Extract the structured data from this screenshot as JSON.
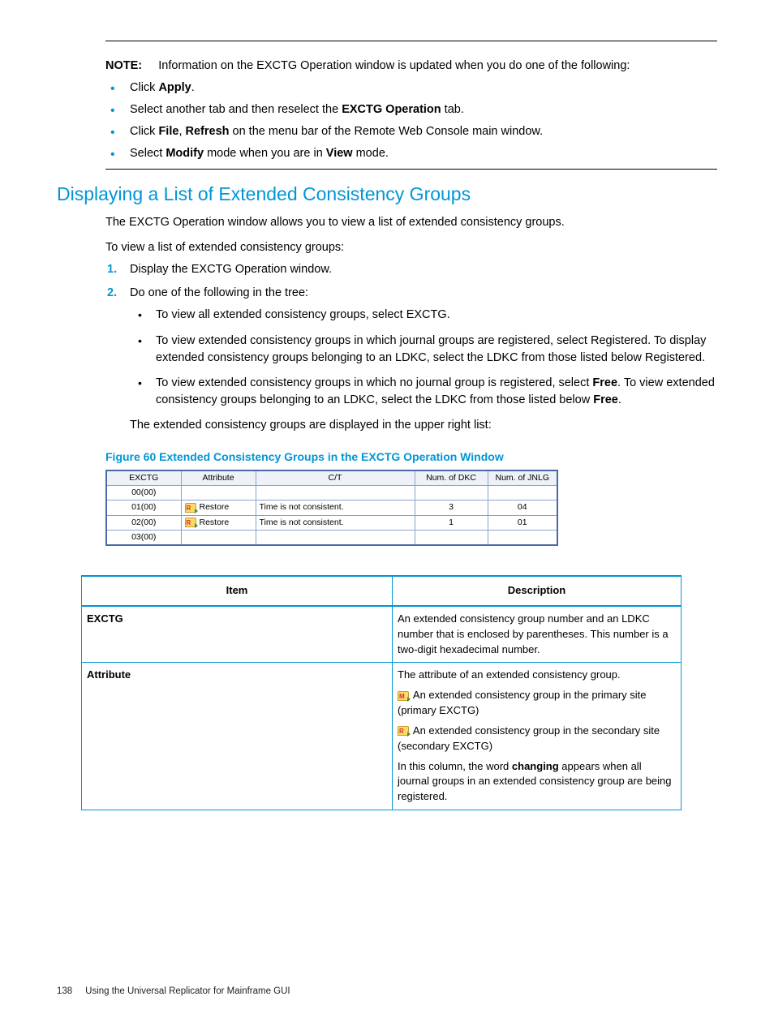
{
  "note": {
    "label": "NOTE:",
    "text": "Information on the EXCTG Operation window is updated when you do one of the following:",
    "bullets": [
      {
        "pre": "Click ",
        "b1": "Apply",
        "post": "."
      },
      {
        "pre": "Select another tab and then reselect the ",
        "b1": "EXCTG Operation",
        "post": " tab."
      },
      {
        "pre": "Click ",
        "b1": "File",
        "mid": ", ",
        "b2": "Refresh",
        "post": " on the menu bar of the Remote Web Console main window."
      },
      {
        "pre": "Select ",
        "b1": "Modify",
        "mid": " mode when you are in ",
        "b2": "View",
        "post": " mode."
      }
    ]
  },
  "section": {
    "heading": "Displaying a List of Extended Consistency Groups",
    "intro1": "The EXCTG Operation window allows you to view a list of extended consistency groups.",
    "intro2": "To view a list of extended consistency groups:",
    "step1": "Display the EXCTG Operation window.",
    "step2_lead": "Do one of the following in the tree:",
    "step2_items": [
      "To view all extended consistency groups, select EXCTG.",
      "To view extended consistency groups in which journal groups are registered, select Registered. To display extended consistency groups belonging to an LDKC, select the LDKC from those listed below Registered."
    ],
    "step2_item3": {
      "pre": "To view extended consistency groups in which no journal group is registered, select ",
      "b1": "Free",
      "mid": ". To view extended consistency groups belonging to an LDKC, select the LDKC from those listed below ",
      "b2": "Free",
      "post": "."
    },
    "after_list": "The extended consistency groups are displayed in the upper right list:",
    "figure_caption": "Figure 60 Extended Consistency Groups in the EXCTG Operation Window"
  },
  "grid": {
    "headers": [
      "EXCTG",
      "Attribute",
      "C/T",
      "Num. of DKC",
      "Num. of JNLG"
    ],
    "rows": [
      {
        "exctg": "00(00)",
        "attr": "",
        "icon": false,
        "ct": "",
        "dkc": "",
        "jnlg": ""
      },
      {
        "exctg": "01(00)",
        "attr": "Restore",
        "icon": true,
        "ct": "Time is not consistent.",
        "dkc": "3",
        "jnlg": "04"
      },
      {
        "exctg": "02(00)",
        "attr": "Restore",
        "icon": true,
        "ct": "Time is not consistent.",
        "dkc": "1",
        "jnlg": "01"
      },
      {
        "exctg": "03(00)",
        "attr": "",
        "icon": false,
        "ct": "",
        "dkc": "",
        "jnlg": ""
      }
    ]
  },
  "desc_table": {
    "th1": "Item",
    "th2": "Description",
    "rows": {
      "r1": {
        "item": "EXCTG",
        "p1": "An extended consistency group number and an LDKC number that is enclosed by parentheses. This number is a two-digit hexadecimal number."
      },
      "r2": {
        "item": "Attribute",
        "p1": "The attribute of an extended consistency group.",
        "p2": " An extended consistency group in the primary site (primary EXCTG)",
        "p3": " An extended consistency group in the secondary site (secondary EXCTG)",
        "p4_pre": "In this column, the word ",
        "p4_b": "changing",
        "p4_post": " appears when all journal groups in an extended consistency group are being registered."
      }
    }
  },
  "footer": {
    "page": "138",
    "title": "Using the Universal Replicator for Mainframe GUI"
  }
}
